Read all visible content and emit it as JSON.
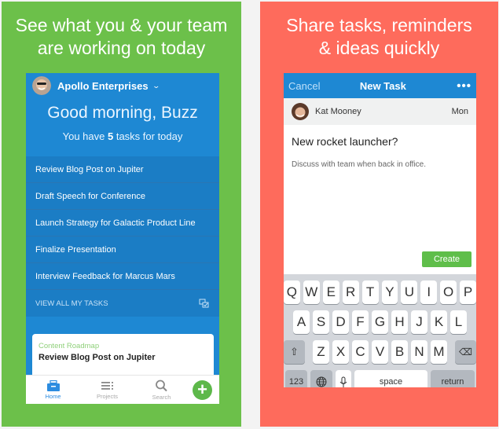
{
  "left_panel": {
    "headline": "See what you & your team\nare working on today",
    "bg_color": "#6cc04a",
    "app": {
      "org_name": "Apollo Enterprises",
      "greeting": "Good morning, Buzz",
      "summary_prefix": "You have ",
      "task_count": "5",
      "summary_suffix": " tasks for today",
      "tasks": [
        "Review Blog Post on Jupiter",
        "Draft Speech for Conference",
        "Launch Strategy for Galactic Product Line",
        "Finalize Presentation",
        "Interview Feedback for Marcus Mars"
      ],
      "view_all_label": "VIEW ALL MY TASKS",
      "card": {
        "project": "Content Roadmap",
        "title": "Review Blog Post on Jupiter"
      },
      "tabs": [
        {
          "label": "Home",
          "icon": "toolbox-icon",
          "active": true
        },
        {
          "label": "Projects",
          "icon": "list-icon",
          "active": false
        },
        {
          "label": "Search",
          "icon": "search-icon",
          "active": false
        }
      ],
      "accent_color": "#1e88d3"
    }
  },
  "right_panel": {
    "headline": "Share tasks, reminders\n& ideas quickly",
    "bg_color": "#fe6b5c",
    "app": {
      "nav": {
        "cancel": "Cancel",
        "title": "New Task",
        "more": "•••"
      },
      "assignee": "Kat Mooney",
      "due": "Mon",
      "task_title": "New rocket launcher?",
      "task_description": "Discuss with team when back in office.",
      "create_label": "Create",
      "keyboard": {
        "row1": [
          "Q",
          "W",
          "E",
          "R",
          "T",
          "Y",
          "U",
          "I",
          "O",
          "P"
        ],
        "row2": [
          "A",
          "S",
          "D",
          "F",
          "G",
          "H",
          "J",
          "K",
          "L"
        ],
        "row3": [
          "Z",
          "X",
          "C",
          "V",
          "B",
          "N",
          "M"
        ],
        "numbers_label": "123",
        "space_label": "space",
        "return_label": "return"
      }
    }
  }
}
